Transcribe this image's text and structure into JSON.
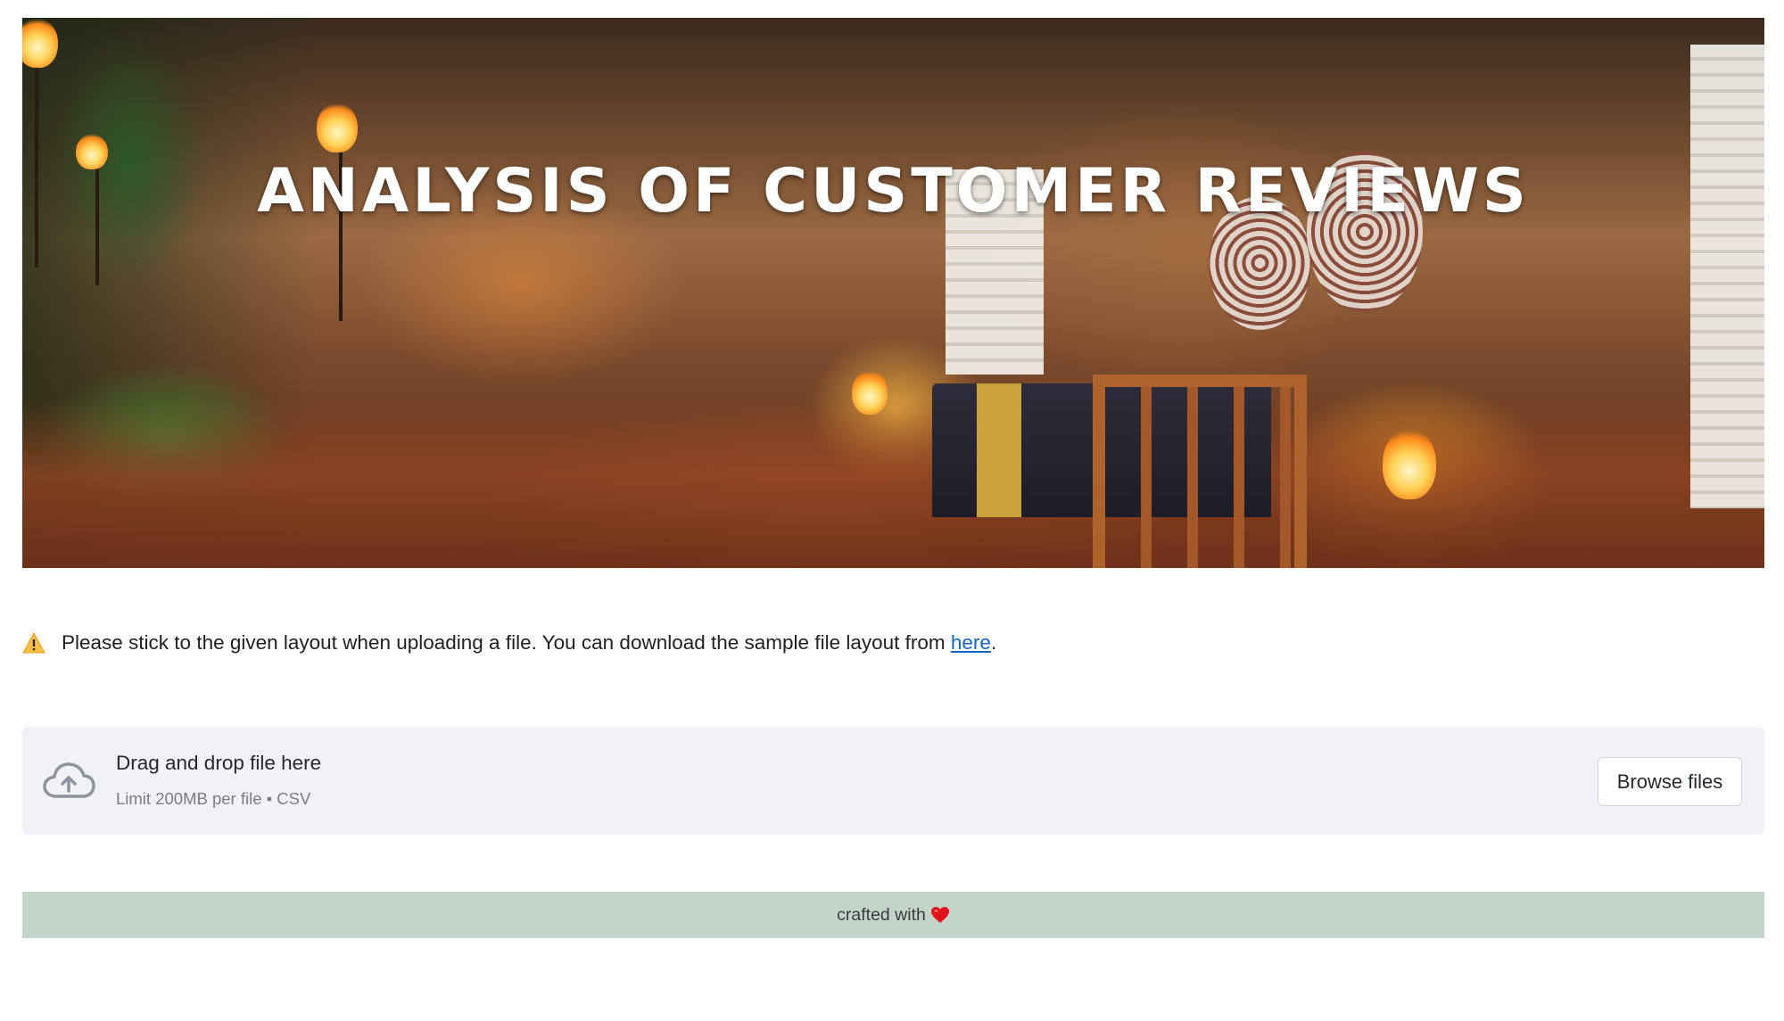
{
  "hero": {
    "title": "ANALYSIS OF CUSTOMER REVIEWS",
    "image_icon": "cave-dining-banner"
  },
  "warning": {
    "icon": "warning-icon",
    "text": "Please stick to the given layout when uploading a file. You can download the sample file layout from ",
    "link_label": "here",
    "suffix": "."
  },
  "uploader": {
    "icon": "cloud-upload-icon",
    "title": "Drag and drop file here",
    "limit": "Limit 200MB per file • CSV",
    "browse_label": "Browse files"
  },
  "footer": {
    "text": "crafted with",
    "icon": "heart-icon",
    "background": "#c3d4c9"
  },
  "colors": {
    "link": "#1565c0",
    "uploader_bg": "#f0f2f6",
    "heart": "#e3131e",
    "warning": "#ffbd45"
  }
}
